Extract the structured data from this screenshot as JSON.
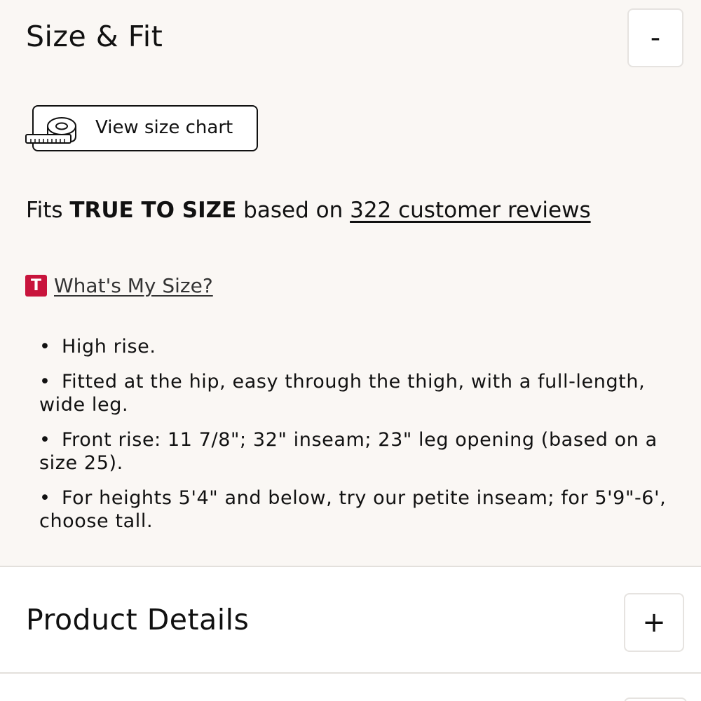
{
  "size_fit": {
    "title": "Size & Fit",
    "toggle": "-",
    "size_chart_label": "View size chart",
    "fit": {
      "prefix": "Fits ",
      "emphasis": "TRUE TO SIZE",
      "middle": " based on ",
      "reviews_link": "322 customer reviews"
    },
    "whats_my_size": {
      "badge": "T",
      "label": "What's My Size?"
    },
    "bullets": [
      "High rise.",
      "Fitted at the hip, easy through the thigh, with a full-length, wide leg.",
      "Front rise: 11 7/8\"; 32\" inseam; 23\" leg opening (based on a size 25).",
      "For heights 5'4\" and below, try our petite inseam; for 5'9\"-6', choose tall."
    ]
  },
  "product_details": {
    "title": "Product Details",
    "toggle": "+"
  },
  "colors": {
    "panel_bg": "#faf7f4",
    "badge_red": "#c8143c",
    "border": "#e3e0dc"
  },
  "icons": {
    "size_chart": "measuring-tape-icon",
    "badge": "t-logo-icon"
  }
}
